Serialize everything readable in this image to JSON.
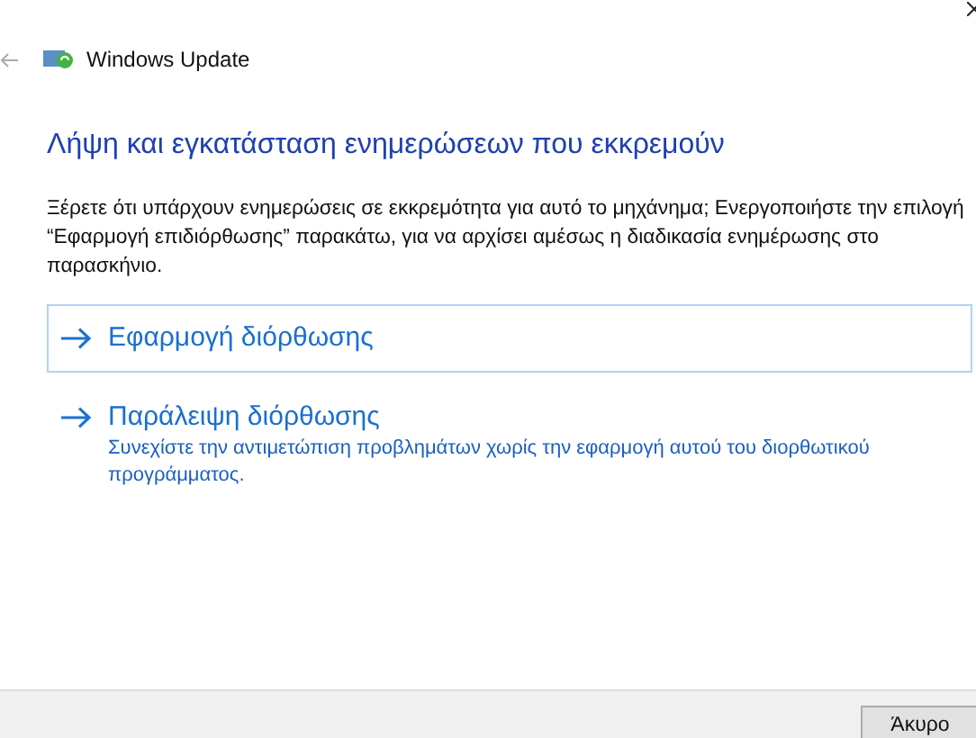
{
  "window": {
    "title": "Windows Update"
  },
  "heading": "Λήψη και εγκατάσταση ενημερώσεων που εκκρεμούν",
  "description": "Ξέρετε ότι υπάρχουν ενημερώσεις σε εκκρεμότητα για αυτό το μηχάνημα; Ενεργοποιήστε την επιλογή “Εφαρμογή επιδιόρθωσης” παρακάτω, για να αρχίσει αμέσως η διαδικασία ενημέρωσης στο παρασκήνιο.",
  "options": [
    {
      "label": "Εφαρμογή διόρθωσης",
      "selected": true
    },
    {
      "label": "Παράλειψη διόρθωσης",
      "detail": "Συνεχίστε την αντιμετώπιση προβλημάτων χωρίς την εφαρμογή αυτού του διορθωτικού προγράμματος.",
      "selected": false
    }
  ],
  "buttons": [
    "Άκυρο"
  ]
}
